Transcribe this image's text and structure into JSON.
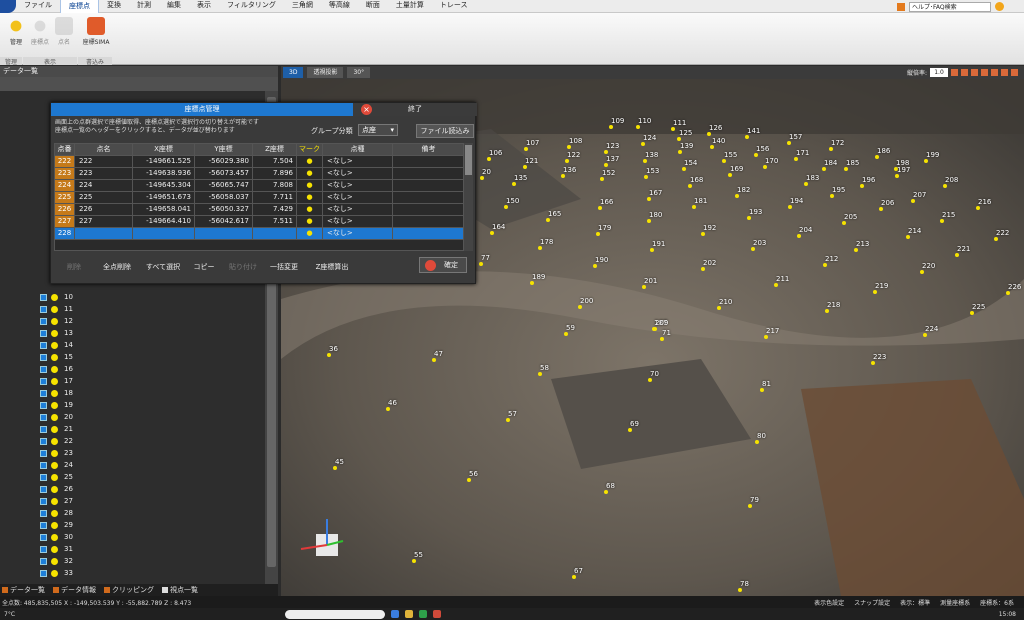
{
  "menubar": {
    "items": [
      "ファイル",
      "座標点",
      "変換",
      "計測",
      "編集",
      "表示",
      "フィルタリング",
      "三角網",
      "等高線",
      "断面",
      "土量計算",
      "トレース"
    ],
    "active_index": 1,
    "help_label": "ヘルプ･FAQ検索"
  },
  "ribbon": {
    "buttons": [
      "管理",
      "座標点",
      "点名",
      "座標SIMA"
    ],
    "groups": [
      "管理",
      "表示",
      "書込み"
    ]
  },
  "left_panel": {
    "title": "データ一覧",
    "tree_items": [
      "10",
      "11",
      "12",
      "13",
      "14",
      "15",
      "16",
      "17",
      "18",
      "19",
      "20",
      "21",
      "22",
      "23",
      "24",
      "25",
      "26",
      "27",
      "28",
      "29",
      "30",
      "31",
      "32",
      "33"
    ],
    "tabs": [
      "データ一覧",
      "データ情報",
      "クリッピング",
      "視点一覧"
    ]
  },
  "viewport": {
    "tabs": [
      "3D",
      "透視投影",
      "30°"
    ],
    "zoom_label": "縦倍率:",
    "zoom_value": "1.0",
    "point_labels": [
      {
        "t": "109"
      },
      {
        "t": "110"
      },
      {
        "t": "111"
      },
      {
        "t": "125"
      },
      {
        "t": "126"
      },
      {
        "t": "141"
      },
      {
        "t": "157"
      },
      {
        "t": "172"
      },
      {
        "t": "186"
      },
      {
        "t": "199"
      },
      {
        "t": "107"
      },
      {
        "t": "108"
      },
      {
        "t": "122"
      },
      {
        "t": "123"
      },
      {
        "t": "124"
      },
      {
        "t": "139"
      },
      {
        "t": "140"
      },
      {
        "t": "155"
      },
      {
        "t": "156"
      },
      {
        "t": "171"
      },
      {
        "t": "184"
      },
      {
        "t": "185"
      },
      {
        "t": "198"
      },
      {
        "t": "106"
      },
      {
        "t": "121"
      },
      {
        "t": "136"
      },
      {
        "t": "137"
      },
      {
        "t": "138"
      },
      {
        "t": "152"
      },
      {
        "t": "153"
      },
      {
        "t": "154"
      },
      {
        "t": "169"
      },
      {
        "t": "170"
      },
      {
        "t": "183"
      },
      {
        "t": "196"
      },
      {
        "t": "197"
      },
      {
        "t": "208"
      },
      {
        "t": "20"
      },
      {
        "t": "135"
      },
      {
        "t": "166"
      },
      {
        "t": "167"
      },
      {
        "t": "168"
      },
      {
        "t": "182"
      },
      {
        "t": "195"
      },
      {
        "t": "207"
      },
      {
        "t": "216"
      },
      {
        "t": "150"
      },
      {
        "t": "165"
      },
      {
        "t": "180"
      },
      {
        "t": "181"
      },
      {
        "t": "194"
      },
      {
        "t": "205"
      },
      {
        "t": "206"
      },
      {
        "t": "215"
      },
      {
        "t": "164"
      },
      {
        "t": "179"
      },
      {
        "t": "192"
      },
      {
        "t": "193"
      },
      {
        "t": "204"
      },
      {
        "t": "214"
      },
      {
        "t": "222"
      },
      {
        "t": "178"
      },
      {
        "t": "191"
      },
      {
        "t": "203"
      },
      {
        "t": "213"
      },
      {
        "t": "221"
      },
      {
        "t": "77"
      },
      {
        "t": "190"
      },
      {
        "t": "202"
      },
      {
        "t": "212"
      },
      {
        "t": "220"
      },
      {
        "t": "189"
      },
      {
        "t": "201"
      },
      {
        "t": "211"
      },
      {
        "t": "219"
      },
      {
        "t": "226"
      },
      {
        "t": "200"
      },
      {
        "t": "210"
      },
      {
        "t": "218"
      },
      {
        "t": "225"
      },
      {
        "t": "187"
      },
      {
        "t": "59"
      },
      {
        "t": "209"
      },
      {
        "t": "71"
      },
      {
        "t": "217"
      },
      {
        "t": "224"
      },
      {
        "t": "36"
      },
      {
        "t": "47"
      },
      {
        "t": "58"
      },
      {
        "t": "223"
      },
      {
        "t": "70"
      },
      {
        "t": "81"
      },
      {
        "t": "46"
      },
      {
        "t": "57"
      },
      {
        "t": "69"
      },
      {
        "t": "80"
      },
      {
        "t": "45"
      },
      {
        "t": "56"
      },
      {
        "t": "68"
      },
      {
        "t": "79"
      },
      {
        "t": "55"
      },
      {
        "t": "67"
      },
      {
        "t": "78"
      }
    ]
  },
  "dialog": {
    "title": "座標点管理",
    "close_label": "終了",
    "info_line1": "画面上の点群選択で座標値取得、座標点選択で選択行の切り替えが可能です",
    "info_line2": "座標点一覧のヘッダーをクリックすると、データが並び替わります",
    "group_label": "グループ分類",
    "group_value": "点座",
    "file_button": "ファイル読込み",
    "columns": [
      "点番",
      "点名",
      "X座標",
      "Y座標",
      "Z座標",
      "マーク",
      "点種",
      "備考"
    ],
    "rows": [
      {
        "no": "222",
        "name": "222",
        "x": "-149661.525",
        "y": "-56029.380",
        "z": "7.504",
        "mark": "●",
        "type": "<なし>"
      },
      {
        "no": "223",
        "name": "223",
        "x": "-149638.936",
        "y": "-56073.457",
        "z": "7.896",
        "mark": "●",
        "type": "<なし>"
      },
      {
        "no": "224",
        "name": "224",
        "x": "-149645.304",
        "y": "-56065.747",
        "z": "7.808",
        "mark": "●",
        "type": "<なし>"
      },
      {
        "no": "225",
        "name": "225",
        "x": "-149651.673",
        "y": "-56058.037",
        "z": "7.711",
        "mark": "●",
        "type": "<なし>"
      },
      {
        "no": "226",
        "name": "226",
        "x": "-149658.041",
        "y": "-56050.327",
        "z": "7.429",
        "mark": "●",
        "type": "<なし>"
      },
      {
        "no": "227",
        "name": "227",
        "x": "-149664.410",
        "y": "-56042.617",
        "z": "7.511",
        "mark": "●",
        "type": "<なし>"
      },
      {
        "no": "228",
        "name": "",
        "x": "",
        "y": "",
        "z": "",
        "mark": "●",
        "type": "<なし>"
      }
    ],
    "selected_row": 6,
    "actions": [
      "削除",
      "全点削除",
      "すべて選択",
      "コピー",
      "貼り付け",
      "一括変更",
      "Z座標算出"
    ],
    "ok_label": "確定"
  },
  "status": {
    "left": "全点数: 485,835,505    X : -149,503.539  Y : -55,882.789  Z : 8.473",
    "right": [
      "表示色設定",
      "スナップ設定",
      "表示：標準",
      "測量座標系",
      "座標系：6系"
    ]
  },
  "taskbar": {
    "weather": "7°C",
    "time": "15:08"
  }
}
